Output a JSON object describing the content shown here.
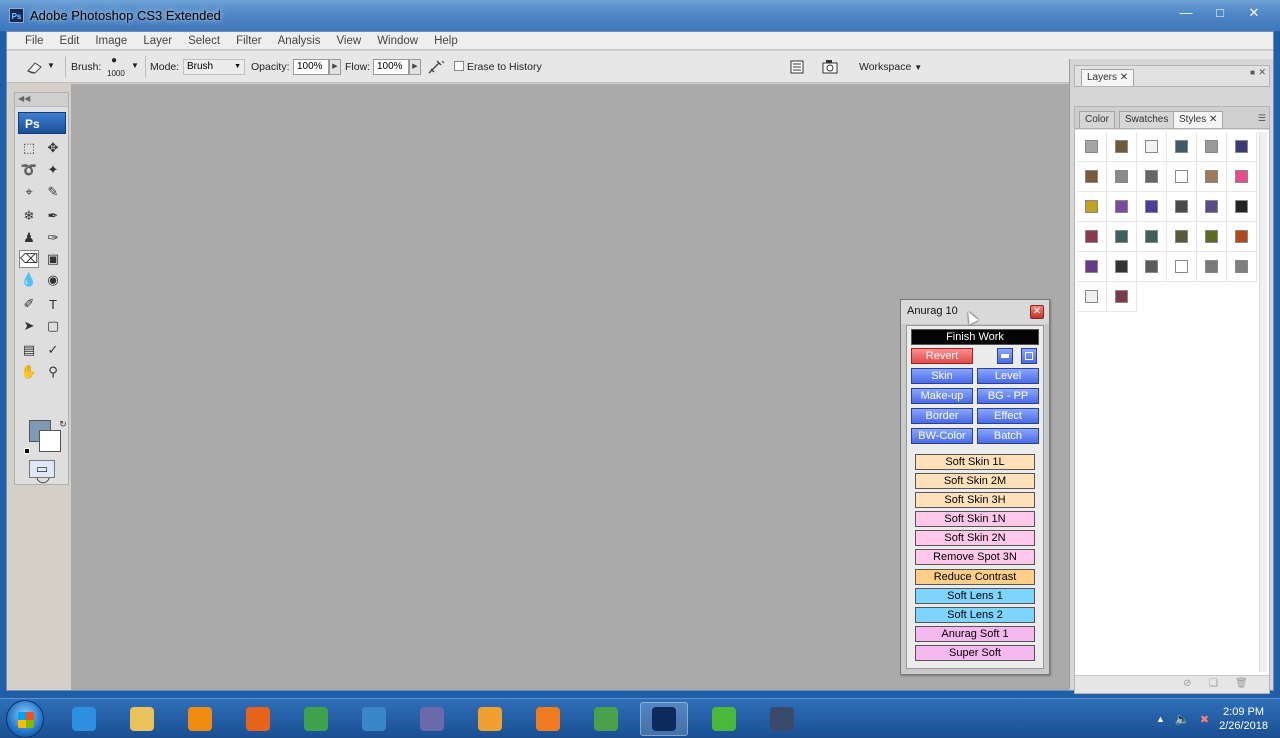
{
  "window": {
    "title": "Adobe Photoshop CS3 Extended",
    "app_badge": "Ps"
  },
  "menu": [
    "File",
    "Edit",
    "Image",
    "Layer",
    "Select",
    "Filter",
    "Analysis",
    "View",
    "Window",
    "Help"
  ],
  "options": {
    "brush_label": "Brush:",
    "brush_size": "1000",
    "mode_label": "Mode:",
    "mode_value": "Brush",
    "opacity_label": "Opacity:",
    "opacity_value": "100%",
    "flow_label": "Flow:",
    "flow_value": "100%",
    "erase_to_history_label": "Erase to History",
    "workspace_label": "Workspace"
  },
  "toolbox": {
    "logo": "Ps"
  },
  "panels": {
    "layers_tab": "Layers",
    "color_tab": "Color",
    "swatches_tab": "Swatches",
    "styles_tab": "Styles",
    "style_swatches": [
      "#a6a6a6",
      "#6e5b3c",
      "#f1f1f1",
      "#3f5b6a",
      "#9a9a9a",
      "#3b3a78",
      "#7a5a3a",
      "#8a8a8a",
      "#666666",
      "#ffffff",
      "#9f7a5a",
      "#e84c8c",
      "#c2a020",
      "#7b4a9e",
      "#4b3c9e",
      "#4a4a4a",
      "#5a4a8a",
      "#222222",
      "#8a3a4a",
      "#3e6060",
      "#3f5f5a",
      "#5a5a3a",
      "#5f6a20",
      "#b04a1a",
      "#6a3a8a",
      "#333333",
      "#5a5a5a",
      "#ffffff",
      "#7a7a7a",
      "#7f7f7f",
      "#f0f0f0",
      "#7a3a4a"
    ]
  },
  "anurag_panel": {
    "title": "Anurag 10",
    "finish_work": "Finish Work",
    "revert": "Revert",
    "grid_buttons": [
      "Skin",
      "Level",
      "Make-up",
      "BG - PP",
      "Border",
      "Effect",
      "BW-Color",
      "Batch"
    ],
    "actions": [
      {
        "label": "Soft Skin 1L",
        "style": "peach"
      },
      {
        "label": "Soft Skin 2M",
        "style": "peach"
      },
      {
        "label": "Soft Skin 3H",
        "style": "peach"
      },
      {
        "label": "Soft Skin 1N",
        "style": "pink"
      },
      {
        "label": "Soft Skin 2N",
        "style": "pink"
      },
      {
        "label": "Remove Spot 3N",
        "style": "pink"
      },
      {
        "label": "Reduce Contrast",
        "style": "orange"
      },
      {
        "label": "Soft Lens 1",
        "style": "cyan"
      },
      {
        "label": "Soft Lens 2",
        "style": "cyan"
      },
      {
        "label": "Anurag Soft 1",
        "style": "violet"
      },
      {
        "label": "Super Soft",
        "style": "violet"
      }
    ]
  },
  "taskbar": {
    "icons": [
      {
        "name": "ie-icon",
        "color": "#2f8ee0"
      },
      {
        "name": "explorer-icon",
        "color": "#e9c25a"
      },
      {
        "name": "vlc-icon",
        "color": "#f08a10"
      },
      {
        "name": "firefox-icon",
        "color": "#e8631a"
      },
      {
        "name": "chrome-icon",
        "color": "#3fa14a"
      },
      {
        "name": "photo-viewer-icon",
        "color": "#3a86c8"
      },
      {
        "name": "media-icon",
        "color": "#6a6aaa"
      },
      {
        "name": "uc-browser-icon",
        "color": "#f0a030"
      },
      {
        "name": "player-icon",
        "color": "#f07a20"
      },
      {
        "name": "network-icon",
        "color": "#4aa04a"
      },
      {
        "name": "photoshop-icon",
        "color": "#0d2a5c"
      },
      {
        "name": "utorrent-icon",
        "color": "#4ab83a"
      },
      {
        "name": "save-icon",
        "color": "#3a4a6a"
      }
    ],
    "clock_time": "2:09 PM",
    "clock_date": "2/26/2018"
  }
}
